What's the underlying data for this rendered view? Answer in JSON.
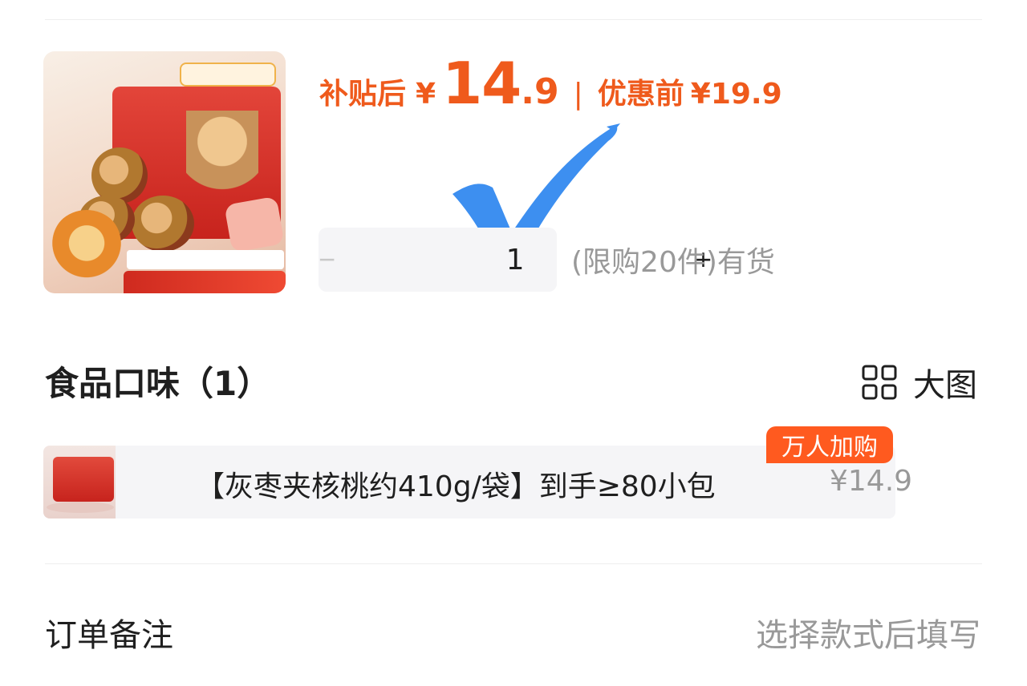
{
  "product": {
    "price_label": "补贴后",
    "currency": "¥",
    "price_integer": "14",
    "price_decimal": ".9",
    "separator": "|",
    "original_label": "优惠前",
    "original_price": "¥19.9",
    "image_icon": "product-image"
  },
  "quantity": {
    "minus": "−",
    "value": "1",
    "plus": "+",
    "stock_text": "(限购20件)有货"
  },
  "flavor_section": {
    "title": "食品口味（1）",
    "view_toggle_label": "大图",
    "view_toggle_icon": "grid-icon"
  },
  "options": [
    {
      "label": "【灰枣夹核桃约410g/袋】到手≥80小包",
      "price": "¥14.9",
      "badge": "万人加购"
    }
  ],
  "order_note": {
    "label": "订单备注",
    "placeholder": "选择款式后填写"
  },
  "colors": {
    "accent": "#ef5a1c",
    "badge": "#ff5a1f",
    "check_mark": "#3d8ff0",
    "muted_text": "#999999"
  }
}
